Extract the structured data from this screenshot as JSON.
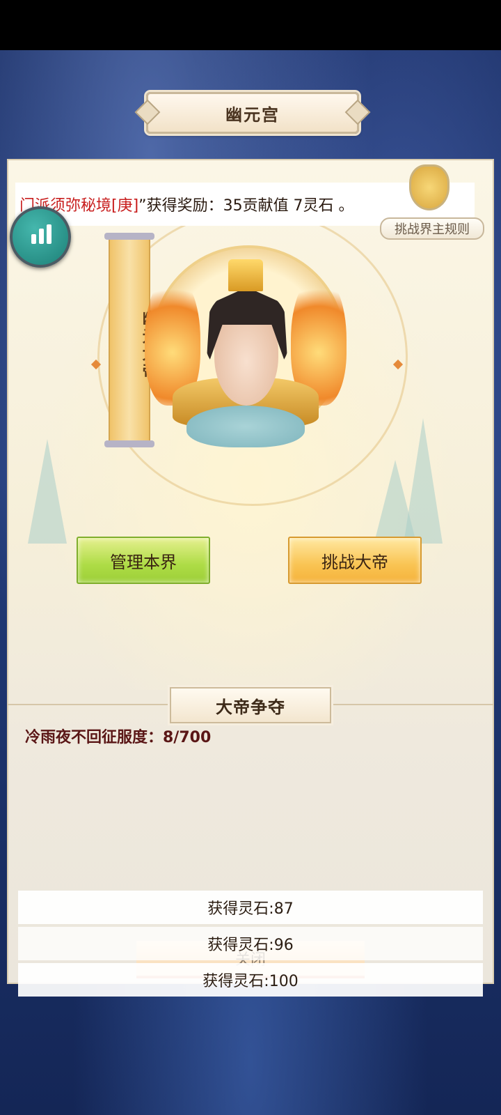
{
  "header": {
    "title": "幽元宫"
  },
  "ticker": {
    "sect_part": "门派须弥秘境[庚]",
    "message_part": "”获得奖励：35贡献值 7灵石 。"
  },
  "rules": {
    "label": "挑战界主规则"
  },
  "emperor": {
    "title": "幽元大帝"
  },
  "actions": {
    "manage_label": "管理本界",
    "challenge_label": "挑战大帝"
  },
  "contest": {
    "section_title": "大帝争夺",
    "progress_text": "冷雨夜不回征服度：8/700"
  },
  "rewards": [
    {
      "text": "获得灵石:87"
    },
    {
      "text": "获得灵石:96"
    },
    {
      "text": "获得灵石:100"
    }
  ],
  "footer": {
    "close_label": "关闭"
  },
  "colors": {
    "ticker_red": "#c81e1e",
    "manage_button": "#aedc46",
    "challenge_button": "#f9c453",
    "stats_button": "#2a968b"
  },
  "icons": {
    "stats": "bar-chart-icon",
    "rules": "medal-icon"
  }
}
